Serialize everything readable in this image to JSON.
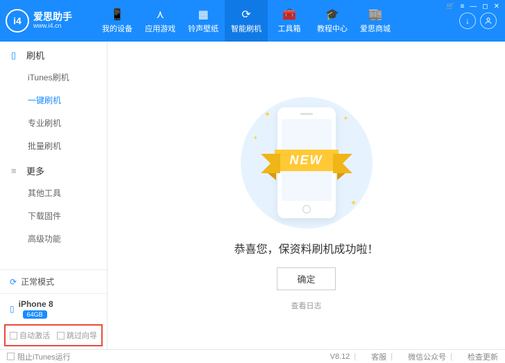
{
  "header": {
    "logo_initials": "i4",
    "title": "爱思助手",
    "subtitle": "www.i4.cn",
    "nav": [
      {
        "label": "我的设备"
      },
      {
        "label": "应用游戏"
      },
      {
        "label": "铃声壁纸"
      },
      {
        "label": "智能刷机"
      },
      {
        "label": "工具箱"
      },
      {
        "label": "教程中心"
      },
      {
        "label": "爱思商城"
      }
    ],
    "download_icon": "↓",
    "account_icon": "◯"
  },
  "sidebar": {
    "group1": {
      "title": "刷机",
      "items": [
        "iTunes刷机",
        "一键刷机",
        "专业刷机",
        "批量刷机"
      ]
    },
    "group2": {
      "title": "更多",
      "items": [
        "其他工具",
        "下载固件",
        "高级功能"
      ]
    },
    "status_label": "正常模式",
    "device_name": "iPhone 8",
    "device_storage": "64GB",
    "auto_activate": "自动激活",
    "skip_guide": "跳过向导"
  },
  "main": {
    "new_badge": "NEW",
    "success_text": "恭喜您，保资料刷机成功啦！",
    "ok_button": "确定",
    "view_log": "查看日志"
  },
  "footer": {
    "block_itunes": "阻止iTunes运行",
    "version": "V8.12",
    "support": "客服",
    "wechat": "微信公众号",
    "check_update": "检查更新"
  }
}
